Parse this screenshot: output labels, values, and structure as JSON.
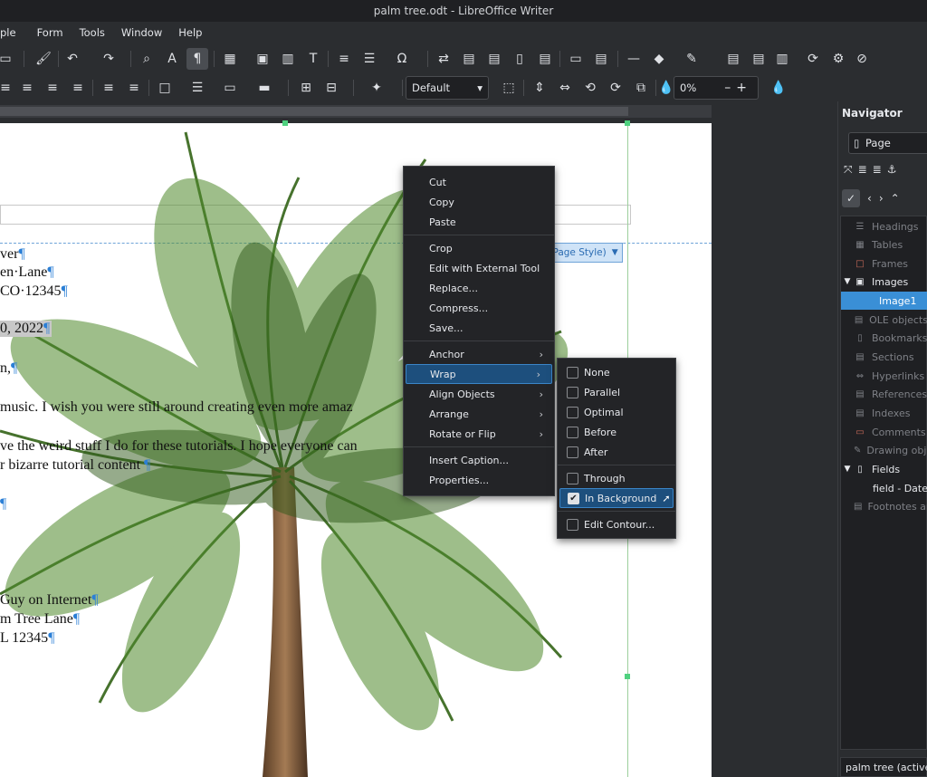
{
  "window": {
    "title": "palm tree.odt - LibreOffice Writer"
  },
  "menubar": [
    "ple",
    "Form",
    "Tools",
    "Window",
    "Help"
  ],
  "toolbar2": {
    "style_combo": "Default",
    "transparency": "0%"
  },
  "document": {
    "lines": [
      "ver¶",
      "en·Lane¶",
      "CO·12345¶",
      "0, 2022¶",
      "n,¶",
      "music. I wish you were still around creating even more amaz",
      "ve the weird stuff I do for these tutorials. I hope everyone can",
      "r bizarre tutorial content ¶",
      "¶",
      "Guy on Internet¶",
      "m Tree Lane¶",
      "L 12345¶"
    ],
    "page_style_label": "t Page Style)"
  },
  "context_menu": {
    "items": [
      {
        "label": "Cut"
      },
      {
        "label": "Copy"
      },
      {
        "label": "Paste"
      },
      {
        "label": "Crop"
      },
      {
        "label": "Edit with External Tool"
      },
      {
        "label": "Replace..."
      },
      {
        "label": "Compress..."
      },
      {
        "label": "Save..."
      },
      {
        "label": "Anchor"
      },
      {
        "label": "Wrap"
      },
      {
        "label": "Align Objects"
      },
      {
        "label": "Arrange"
      },
      {
        "label": "Rotate or Flip"
      },
      {
        "label": "Insert Caption..."
      },
      {
        "label": "Properties..."
      }
    ]
  },
  "wrap_submenu": {
    "items": [
      {
        "label": "None",
        "checked": false
      },
      {
        "label": "Parallel",
        "checked": false
      },
      {
        "label": "Optimal",
        "checked": false
      },
      {
        "label": "Before",
        "checked": false
      },
      {
        "label": "After",
        "checked": false
      },
      {
        "label": "Through",
        "checked": false
      },
      {
        "label": "In Background",
        "checked": true
      },
      {
        "label": "Edit Contour...",
        "checked": false
      }
    ]
  },
  "navigator": {
    "title": "Navigator",
    "combo": "Page",
    "tree": [
      {
        "label": "Headings"
      },
      {
        "label": "Tables"
      },
      {
        "label": "Frames"
      },
      {
        "label": "Images"
      },
      {
        "label": "Image1"
      },
      {
        "label": "OLE objects"
      },
      {
        "label": "Bookmarks"
      },
      {
        "label": "Sections"
      },
      {
        "label": "Hyperlinks"
      },
      {
        "label": "References"
      },
      {
        "label": "Indexes"
      },
      {
        "label": "Comments"
      },
      {
        "label": "Drawing obje"
      },
      {
        "label": "Fields"
      },
      {
        "label": "field - Date"
      },
      {
        "label": "Footnotes an"
      }
    ],
    "status": "palm tree (active)"
  },
  "colors": {
    "accent": "#3a8fd6",
    "menu_bg": "#232427",
    "highlight": "#1d4f7d"
  }
}
